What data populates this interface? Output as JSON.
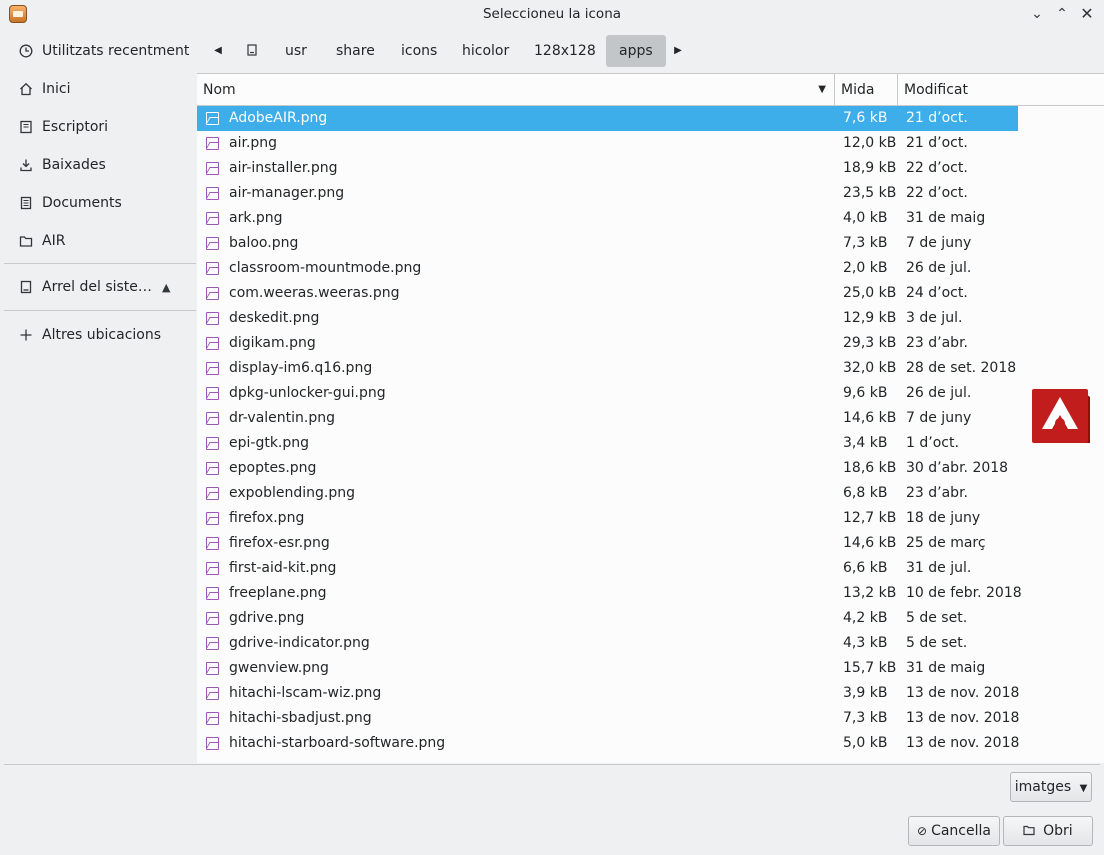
{
  "window": {
    "title": "Seleccioneu la icona"
  },
  "sidebar": {
    "items": [
      {
        "label": "Utilitzats recentment",
        "icon": "clock-icon"
      },
      {
        "label": "Inici",
        "icon": "home-icon"
      },
      {
        "label": "Escriptori",
        "icon": "desktop-icon"
      },
      {
        "label": "Baixades",
        "icon": "download-icon"
      },
      {
        "label": "Documents",
        "icon": "document-icon"
      },
      {
        "label": "AIR",
        "icon": "folder-icon"
      }
    ],
    "root": {
      "label": "Arrel del siste…",
      "icon": "drive-icon"
    },
    "other": {
      "label": "Altres ubicacions",
      "icon": "plus-icon"
    }
  },
  "path": {
    "crumbs": [
      "usr",
      "share",
      "icons",
      "hicolor",
      "128x128",
      "apps"
    ],
    "active": "apps"
  },
  "columns": {
    "name": "Nom",
    "size": "Mida",
    "modified": "Modificat"
  },
  "files": [
    {
      "name": "AdobeAIR.png",
      "size": "7,6 kB",
      "date": "21 d’oct."
    },
    {
      "name": "air.png",
      "size": "12,0 kB",
      "date": "21 d’oct."
    },
    {
      "name": "air-installer.png",
      "size": "18,9 kB",
      "date": "22 d’oct."
    },
    {
      "name": "air-manager.png",
      "size": "23,5 kB",
      "date": "22 d’oct."
    },
    {
      "name": "ark.png",
      "size": "4,0 kB",
      "date": "31 de maig"
    },
    {
      "name": "baloo.png",
      "size": "7,3 kB",
      "date": "7 de juny"
    },
    {
      "name": "classroom-mountmode.png",
      "size": "2,0 kB",
      "date": "26 de jul."
    },
    {
      "name": "com.weeras.weeras.png",
      "size": "25,0 kB",
      "date": "24 d’oct."
    },
    {
      "name": "deskedit.png",
      "size": "12,9 kB",
      "date": "3 de jul."
    },
    {
      "name": "digikam.png",
      "size": "29,3 kB",
      "date": "23 d’abr."
    },
    {
      "name": "display-im6.q16.png",
      "size": "32,0 kB",
      "date": "28 de set. 2018"
    },
    {
      "name": "dpkg-unlocker-gui.png",
      "size": "9,6 kB",
      "date": "26 de jul."
    },
    {
      "name": "dr-valentin.png",
      "size": "14,6 kB",
      "date": "7 de juny"
    },
    {
      "name": "epi-gtk.png",
      "size": "3,4 kB",
      "date": "1 d’oct."
    },
    {
      "name": "epoptes.png",
      "size": "18,6 kB",
      "date": "30 d’abr. 2018"
    },
    {
      "name": "expoblending.png",
      "size": "6,8 kB",
      "date": "23 d’abr."
    },
    {
      "name": "firefox.png",
      "size": "12,7 kB",
      "date": "18 de juny"
    },
    {
      "name": "firefox-esr.png",
      "size": "14,6 kB",
      "date": "25 de març"
    },
    {
      "name": "first-aid-kit.png",
      "size": "6,6 kB",
      "date": "31 de jul."
    },
    {
      "name": "freeplane.png",
      "size": "13,2 kB",
      "date": "10 de febr. 2018"
    },
    {
      "name": "gdrive.png",
      "size": "4,2 kB",
      "date": "5 de set."
    },
    {
      "name": "gdrive-indicator.png",
      "size": "4,3 kB",
      "date": "5 de set."
    },
    {
      "name": "gwenview.png",
      "size": "15,7 kB",
      "date": "31 de maig"
    },
    {
      "name": "hitachi-lscam-wiz.png",
      "size": "3,9 kB",
      "date": "13 de nov. 2018"
    },
    {
      "name": "hitachi-sbadjust.png",
      "size": "7,3 kB",
      "date": "13 de nov. 2018"
    },
    {
      "name": "hitachi-starboard-software.png",
      "size": "5,0 kB",
      "date": "13 de nov. 2018"
    }
  ],
  "filter": {
    "label": "imatges"
  },
  "buttons": {
    "cancel": "Cancella",
    "open": "Obri"
  },
  "colors": {
    "accent": "#3daee9",
    "file_icon": "#9b59b6",
    "preview_red": "#c21d1d"
  }
}
